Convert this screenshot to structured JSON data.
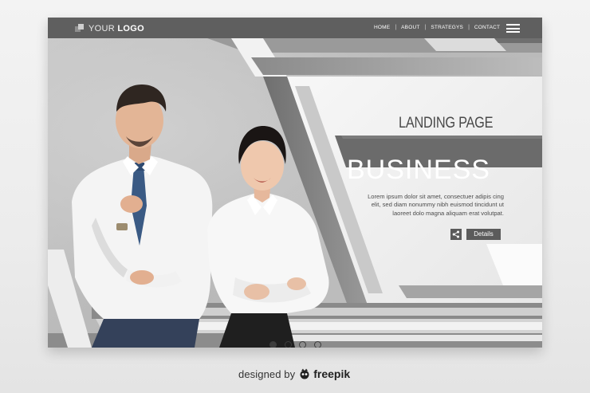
{
  "navbar": {
    "logo_light": "YOUR ",
    "logo_bold": "LOGO",
    "links": [
      {
        "label": "HOME"
      },
      {
        "label": "ABOUT"
      },
      {
        "label": "STRATEGYS"
      },
      {
        "label": "CONTACT"
      }
    ],
    "separator": "|"
  },
  "hero": {
    "subtitle": "LANDING PAGE",
    "title": "BUSINESS",
    "description_lines": [
      "Lorem ipsum dolor sit amet, consectuer adipis cing",
      "elit, sed diam nonummy nibh euismod tincidunt ut",
      "laoreet dolo magna aliquam erat volutpat."
    ],
    "details_label": "Details",
    "share_icon": "share-icon"
  },
  "slider": {
    "total": 4,
    "active_index": 0
  },
  "footer": {
    "designed_by": "designed by",
    "brand": "freepik"
  },
  "colors": {
    "navbar": "#5f5f5f",
    "accent_dark": "#5b5b5b",
    "title_white": "#ffffff",
    "text_gray": "#4d4d4d"
  }
}
